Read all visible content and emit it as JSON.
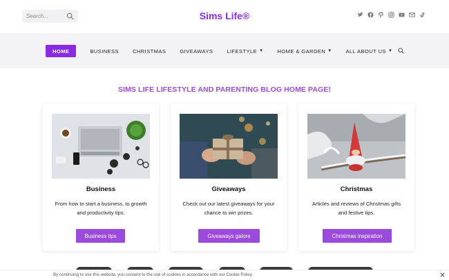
{
  "header": {
    "brand": "Sims Life®",
    "search_placeholder": "Search...",
    "social_icons": [
      "twitter-icon",
      "facebook-icon",
      "pinterest-icon",
      "instagram-icon",
      "youtube-icon",
      "email-icon",
      "tiktok-icon"
    ]
  },
  "nav": {
    "items": [
      {
        "label": "HOME",
        "active": true
      },
      {
        "label": "BUSINESS"
      },
      {
        "label": "CHRISTMAS"
      },
      {
        "label": "GIVEAWAYS"
      },
      {
        "label": "LIFESTYLE",
        "dropdown": true
      },
      {
        "label": "HOME & GARDEN",
        "dropdown": true
      },
      {
        "label": "ALL ABOUT US",
        "dropdown": true
      }
    ]
  },
  "main": {
    "headline": "SIMS LIFE LIFESTYLE AND PARENTING BLOG HOME PAGE!",
    "cards": [
      {
        "title": "Business",
        "desc": "From how to start a business, to growth and productivity tips.",
        "button": "Business tips"
      },
      {
        "title": "Giveaways",
        "desc": "Check out our latest giveaways for your chance to win prizes.",
        "button": "Giveaways galore"
      },
      {
        "title": "Christmas",
        "desc": "Articles and reviews of Christmas gifts and festive tips.",
        "button": "Christmas inspiration"
      }
    ]
  },
  "cookie": {
    "message": "By continuing to use this website, you consent to the use of cookies in accordance with our Cookie Policy."
  },
  "colors": {
    "accent": "#8a2be2",
    "button": "#9b4bdc",
    "nav_bg": "#f3f3f5"
  }
}
